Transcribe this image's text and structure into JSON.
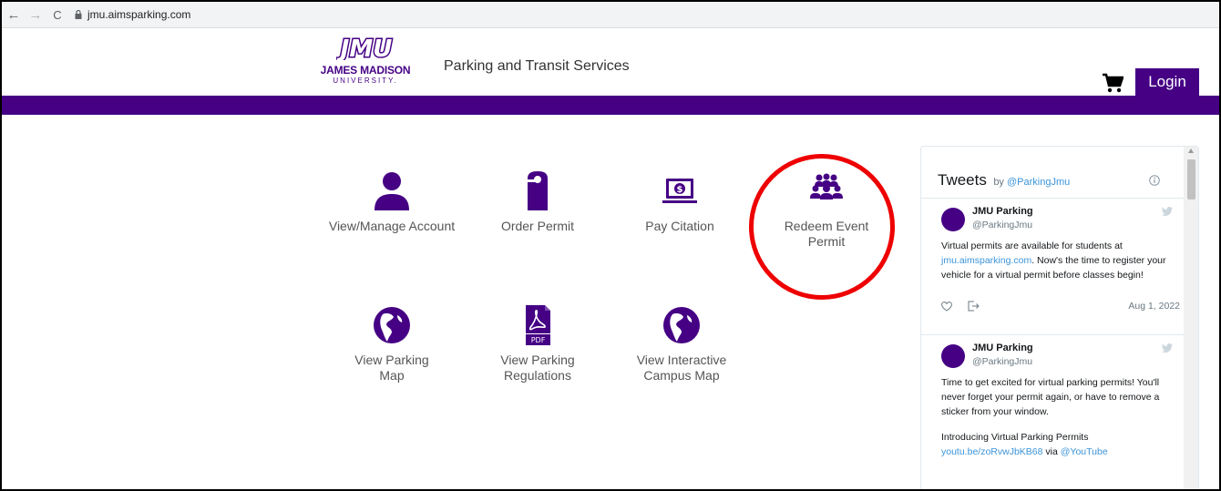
{
  "browser": {
    "back_icon": "←",
    "forward_icon": "→",
    "reload_icon": "C",
    "url": "jmu.aimsparking.com"
  },
  "header": {
    "logo": {
      "mark": "JMU",
      "name": "JAMES MADISON",
      "university": "UNIVERSITY."
    },
    "title": "Parking and Transit Services",
    "login_label": "Login",
    "brand_color": "#450084"
  },
  "tiles": [
    {
      "label": "View/Manage Account",
      "icon": "user-icon"
    },
    {
      "label": "Order Permit",
      "icon": "door-hanger-icon"
    },
    {
      "label": "Pay Citation",
      "icon": "laptop-dollar-icon"
    },
    {
      "label": "Redeem Event Permit",
      "icon": "group-icon"
    },
    {
      "label": "View Parking Map",
      "icon": "globe-icon"
    },
    {
      "label": "View Parking Regulations",
      "icon": "pdf-icon"
    },
    {
      "label": "View Interactive Campus Map",
      "icon": "globe-icon"
    }
  ],
  "twitter": {
    "title": "Tweets",
    "by": "by",
    "by_handle": "@ParkingJmu",
    "tweets": [
      {
        "name": "JMU Parking",
        "handle": "@ParkingJmu",
        "text_before_link": "Virtual permits are available for students at ",
        "link": "jmu.aimsparking.com",
        "text_after_link": ". Now's the time to register your vehicle for a virtual permit before classes begin!",
        "date": "Aug 1, 2022"
      },
      {
        "name": "JMU Parking",
        "handle": "@ParkingJmu",
        "text_1": "Time to get excited for virtual parking permits! You'll never forget your permit again, or have to remove a sticker from your window.",
        "text_2": "Introducing Virtual Parking Permits",
        "link_1": "youtu.be/zoRvwJbKB68",
        "via": " via ",
        "link_2": "@YouTube"
      }
    ]
  },
  "highlight_color": "#e00000"
}
